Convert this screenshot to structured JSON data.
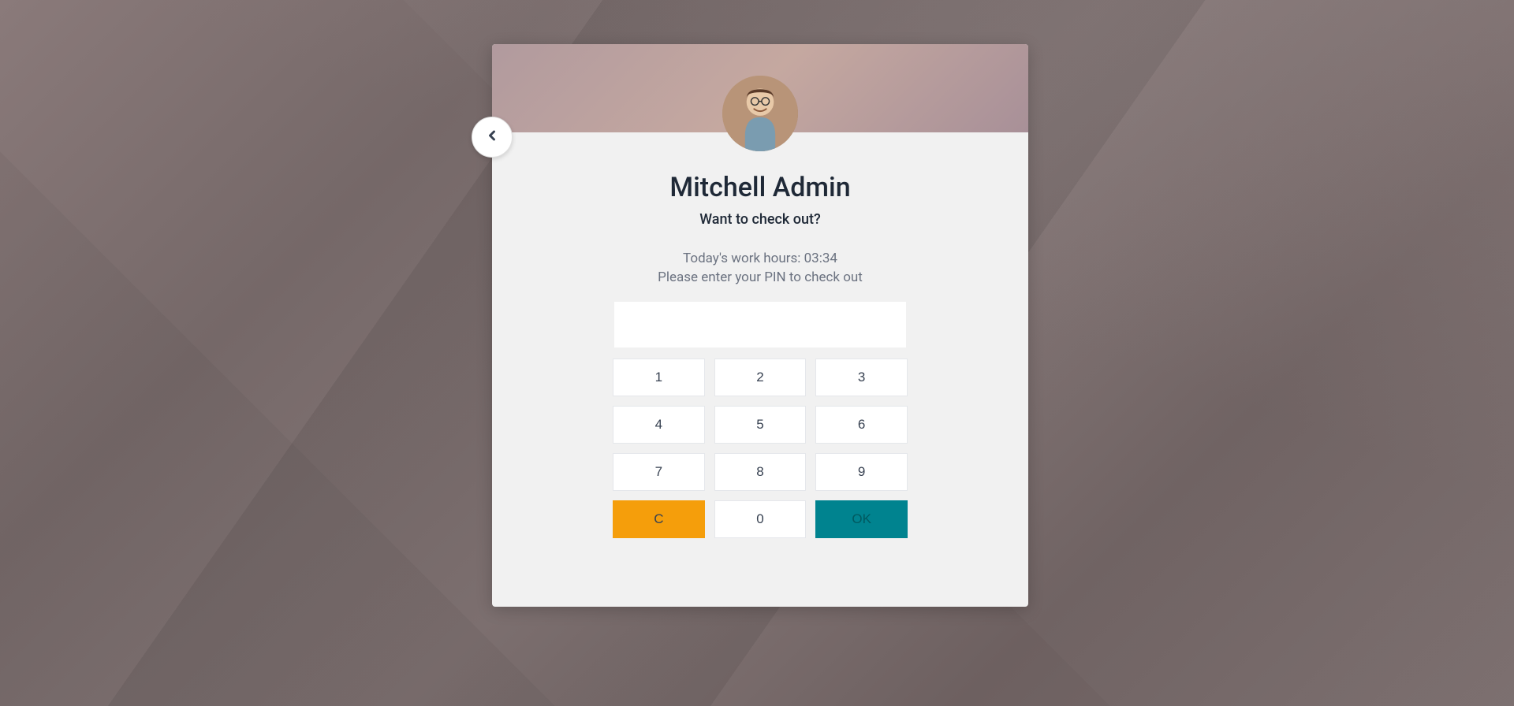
{
  "user": {
    "name": "Mitchell Admin"
  },
  "prompt": {
    "question": "Want to check out?",
    "work_hours_line": "Today's work hours: 03:34",
    "pin_instruction": "Please enter your PIN to check out"
  },
  "pin": {
    "value": ""
  },
  "keypad": {
    "k1": "1",
    "k2": "2",
    "k3": "3",
    "k4": "4",
    "k5": "5",
    "k6": "6",
    "k7": "7",
    "k8": "8",
    "k9": "9",
    "k0": "0",
    "clear": "C",
    "ok": "OK"
  }
}
